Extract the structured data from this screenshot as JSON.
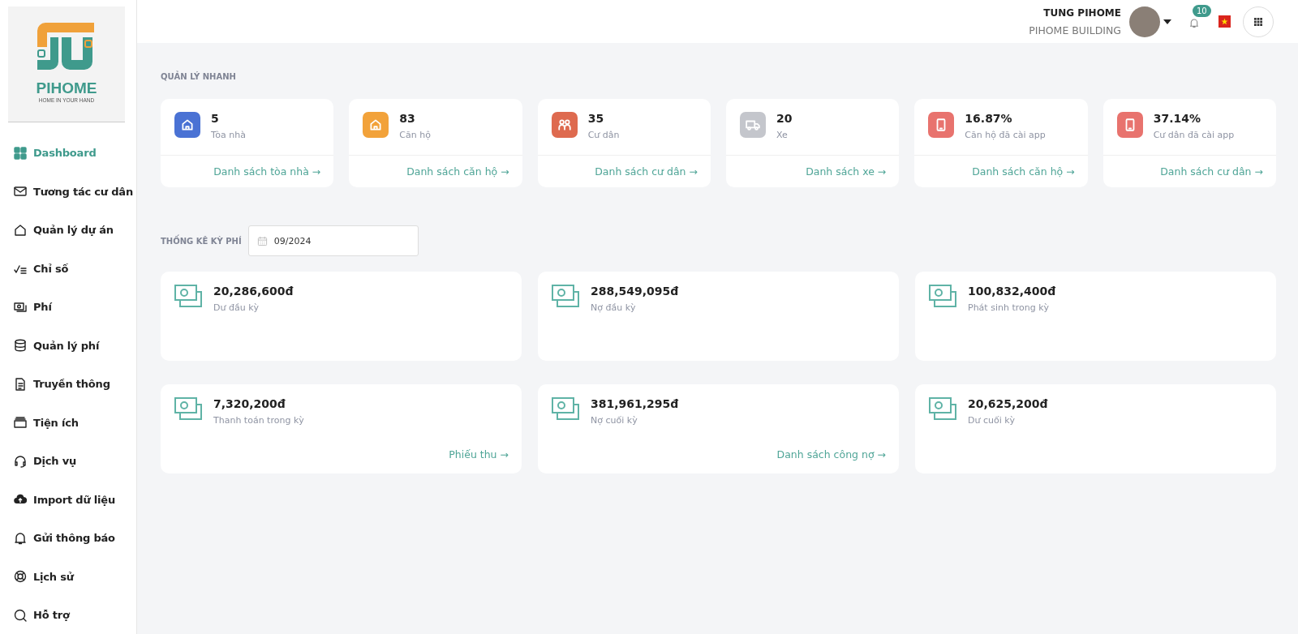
{
  "logo": {
    "name": "PIHOME",
    "tagline": "HOME IN YOUR HAND"
  },
  "sidebar": {
    "items": [
      {
        "label": "Dashboard",
        "selected": true
      },
      {
        "label": "Tương tác cư dân",
        "selected": false
      },
      {
        "label": "Quản lý dự án",
        "selected": false
      },
      {
        "label": "Chỉ số",
        "selected": false
      },
      {
        "label": "Phí",
        "selected": false
      },
      {
        "label": "Quản lý phí",
        "selected": false
      },
      {
        "label": "Truyền thông",
        "selected": false
      },
      {
        "label": "Tiện ích",
        "selected": false
      },
      {
        "label": "Dịch vụ",
        "selected": false
      },
      {
        "label": "Import dữ liệu",
        "selected": false
      },
      {
        "label": "Gửi thông báo",
        "selected": false
      },
      {
        "label": "Lịch sử",
        "selected": false
      },
      {
        "label": "Hỗ trợ",
        "selected": false
      }
    ]
  },
  "header": {
    "user_name": "TUNG PIHOME",
    "building": "PIHOME BUILDING",
    "notification_count": "10"
  },
  "quick_manage": {
    "title": "QUẢN LÝ NHANH",
    "cards": [
      {
        "value": "5",
        "label": "Tòa nhà",
        "link": "Danh sách tòa nhà →",
        "color": "#4a72d4"
      },
      {
        "value": "83",
        "label": "Căn hộ",
        "link": "Danh sách căn hộ →",
        "color": "#f2a23a"
      },
      {
        "value": "35",
        "label": "Cư dân",
        "link": "Danh sách cư dân →",
        "color": "#de6a4f"
      },
      {
        "value": "20",
        "label": "Xe",
        "link": "Danh sách xe →",
        "color": "#c4c6cc"
      },
      {
        "value": "16.87%",
        "label": "Căn hộ đã cài app",
        "link": "Danh sách căn hộ →",
        "color": "#e8736e"
      },
      {
        "value": "37.14%",
        "label": "Cư dân đã cài app",
        "link": "Danh sách cư dân →",
        "color": "#e8736e"
      }
    ]
  },
  "fee_stats": {
    "title": "THỐNG KÊ KỲ PHÍ",
    "period": "09/2024",
    "cards": [
      {
        "value": "20,286,600đ",
        "label": "Dư đầu kỳ"
      },
      {
        "value": "288,549,095đ",
        "label": "Nợ đầu kỳ"
      },
      {
        "value": "100,832,400đ",
        "label": "Phát sinh trong kỳ"
      },
      {
        "value": "7,320,200đ",
        "label": "Thanh toán trong kỳ",
        "link": "Phiếu thu →"
      },
      {
        "value": "381,961,295đ",
        "label": "Nợ cuối kỳ",
        "link": "Danh sách công nợ →"
      },
      {
        "value": "20,625,200đ",
        "label": "Dư cuối kỳ"
      }
    ]
  }
}
